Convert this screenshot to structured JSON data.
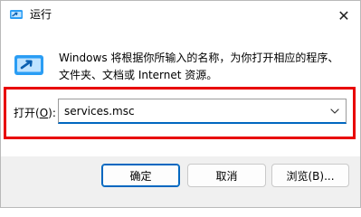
{
  "window": {
    "title": "运行",
    "close_glyph": "✕"
  },
  "body": {
    "description": "Windows 将根据你所输入的名称，为你打开相应的程序、文件夹、文档或 Internet 资源。",
    "open_label_prefix": "打开(",
    "open_label_hotkey": "O",
    "open_label_suffix": "):",
    "command_value": "services.msc"
  },
  "buttons": {
    "ok": "确定",
    "cancel": "取消",
    "browse": "浏览(B)..."
  },
  "icons": {
    "title": "run-app-icon",
    "body": "run-app-icon",
    "dropdown": "chevron-down-icon",
    "close": "close-icon"
  },
  "colors": {
    "accent": "#0067c0",
    "highlight": "#e80000"
  }
}
